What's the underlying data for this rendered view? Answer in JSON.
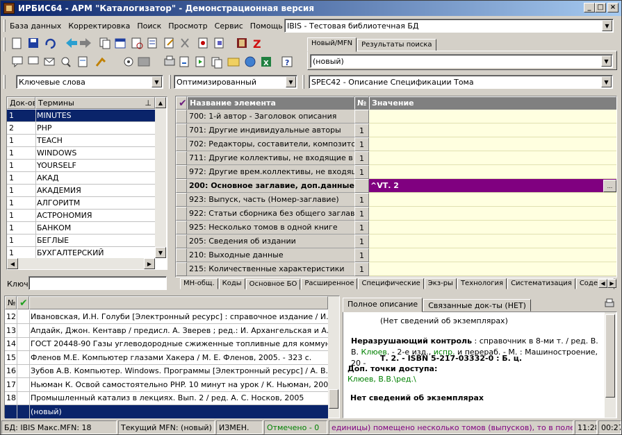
{
  "window": {
    "title": "ИРБИС64 - АРМ \"Каталогизатор\" - Демонстрационная версия",
    "btn_min": "_",
    "btn_max": "□",
    "btn_close": "×"
  },
  "menu": [
    "База данных",
    "Корректировка",
    "Поиск",
    "Просмотр",
    "Сервис",
    "Помощь"
  ],
  "db_select": {
    "value": "IBIS - Тестовая библиотечная БД"
  },
  "record_tabs": [
    {
      "label": "Новый/MFN",
      "active": true
    },
    {
      "label": "Результаты поиска",
      "active": false
    }
  ],
  "record_select": {
    "value": "(новый)"
  },
  "dict_select": {
    "value": "Ключевые слова"
  },
  "mode_select": {
    "value": "Оптимизированный"
  },
  "worksheet_select": {
    "value": "SPEC42 - Описание Спецификации Тома"
  },
  "dict": {
    "col_docs": "Док-ов",
    "col_terms": "Термины",
    "key_label": "Ключ:",
    "key_value": "",
    "rows": [
      {
        "n": "1",
        "t": "MINUTES",
        "sel": true
      },
      {
        "n": "2",
        "t": "PHP"
      },
      {
        "n": "1",
        "t": "TEACH"
      },
      {
        "n": "1",
        "t": "WINDOWS"
      },
      {
        "n": "1",
        "t": "YOURSELF"
      },
      {
        "n": "1",
        "t": "АКАД"
      },
      {
        "n": "1",
        "t": "АКАДЕМИЯ"
      },
      {
        "n": "1",
        "t": "АЛГОРИТМ"
      },
      {
        "n": "1",
        "t": "АСТРОНОМИЯ"
      },
      {
        "n": "1",
        "t": "БАНКОМ"
      },
      {
        "n": "1",
        "t": "БЕГЛЫЕ"
      },
      {
        "n": "1",
        "t": "БУХГАЛТЕРСКИЙ"
      }
    ]
  },
  "editor": {
    "col_name": "Название элемента",
    "col_no": "№",
    "col_value": "Значение",
    "check": "✔",
    "rows": [
      {
        "name": "700: 1-й автор - Заголовок описания",
        "no": ""
      },
      {
        "name": "701: Другие индивидуальные авторы",
        "no": "1"
      },
      {
        "name": "702: Редакторы, составители, композиторы ...",
        "no": "1"
      },
      {
        "name": "711: Другие коллективы, не входящие в загол",
        "no": "1"
      },
      {
        "name": "972: Другие врем.коллективы, не входящие в",
        "no": "1"
      },
      {
        "name": "200: Основное заглавие, доп.данные",
        "no": "",
        "bold": true,
        "value": "^VТ. 2",
        "active": true
      },
      {
        "name": "923: Выпуск, часть (Номер-заглавие)",
        "no": "1"
      },
      {
        "name": "922: Статьи сборника без общего заглавия",
        "no": "1"
      },
      {
        "name": "925: Несколько томов в одной книге",
        "no": "1"
      },
      {
        "name": "205: Сведения об издании",
        "no": "1"
      },
      {
        "name": "210: Выходные данные",
        "no": "1"
      },
      {
        "name": "215: Количественные характеристики",
        "no": "1"
      }
    ],
    "ellipsis": "...",
    "tabs": [
      {
        "label": "МН-общ.",
        "active": false
      },
      {
        "label": "Коды",
        "active": false
      },
      {
        "label": "Основное БО",
        "active": true
      },
      {
        "label": "Расширенное",
        "active": false
      },
      {
        "label": "Специфические",
        "active": false
      },
      {
        "label": "Экз-ры",
        "active": false
      },
      {
        "label": "Технология",
        "active": false
      },
      {
        "label": "Систематизация",
        "active": false
      },
      {
        "label": "Содерж.",
        "active": false
      }
    ]
  },
  "results": {
    "col_no": "№",
    "check": "✔",
    "rows": [
      {
        "n": "12",
        "t": "Ивановская, И.Н. Голуби [Электронный ресурс] : справочное издание / И.Н. Иванс"
      },
      {
        "n": "13",
        "t": "Апдайк, Джон. Кентавр / предисл. А. Зверев ; ред.: И. Архангельская и А. Корх, 19"
      },
      {
        "n": "14",
        "t": "ГОСТ 20448-90 Газы углеводородные сжиженные топливные для коммунально-быт"
      },
      {
        "n": "15",
        "t": "Фленов М.Е. Компьютер глазами Хакера / М. Е. Фленов, 2005. - 323 с."
      },
      {
        "n": "16",
        "t": "Зубов А.В. Компьютер. Windows. Программы [Электронный ресурс] / А. В. Зубов, М"
      },
      {
        "n": "17",
        "t": "Ньюман К. Освой самостоятельно PHP. 10 минут на урок / К. Ньюман, 2006. - 255 с"
      },
      {
        "n": "18",
        "t": "Промышленный катализ в лекциях. Вып. 2 / ред. А. С. Носков, 2005"
      },
      {
        "n": "",
        "t": "(новый)",
        "sel": true
      }
    ]
  },
  "desc": {
    "tabs": [
      {
        "label": "Полное описание",
        "active": true
      },
      {
        "label": "Связанные док-ты (НЕТ)",
        "active": false
      }
    ],
    "no_copies_1": "(Нет сведений об экземплярах)",
    "bold_label": "Неразрушающий контроль",
    "text1": " : справочник в 8-ми т. / ред. В. В. ",
    "link1": "Клюев",
    "text2": ". - 2-е изд., ",
    "link2": "испр.",
    "text3": " и перераб. - М. : Машиностроение, 20 -",
    "line3": "Т. 2. - ISBN 5-217-03332-0 : Б. ц.",
    "access_title": "Доп. точки доступа:",
    "access_link": "Клюев, В.В.\\ред.\\",
    "no_copies_2": "Нет сведений об экземплярах"
  },
  "status": {
    "db": "БД: IBIS Макс.MFN: 18",
    "current": "Текущий MFN: (новый)",
    "changed": "ИЗМЕН.",
    "marked": "Отмечено - 0",
    "hint": "единицы) помещено несколько томов (выпусков), то в поле в водятся",
    "time1": "11:28",
    "time2": "00:27"
  },
  "colors": {
    "selection": "#0a246a",
    "active_field": "#800080",
    "value_bg": "#ffffe0",
    "link": "#008000",
    "hint": "#800080"
  }
}
